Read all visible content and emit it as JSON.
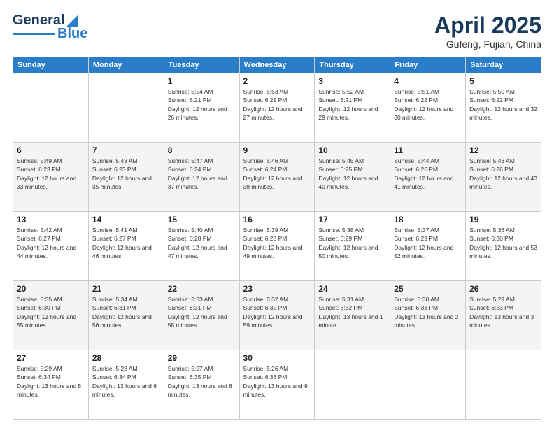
{
  "header": {
    "logo": {
      "line1": "General",
      "line2": "Blue"
    },
    "title": "April 2025",
    "subtitle": "Gufeng, Fujian, China"
  },
  "days_of_week": [
    "Sunday",
    "Monday",
    "Tuesday",
    "Wednesday",
    "Thursday",
    "Friday",
    "Saturday"
  ],
  "weeks": [
    [
      {
        "day": "",
        "info": ""
      },
      {
        "day": "",
        "info": ""
      },
      {
        "day": "1",
        "sunrise": "5:54 AM",
        "sunset": "6:21 PM",
        "daylight": "12 hours and 26 minutes."
      },
      {
        "day": "2",
        "sunrise": "5:53 AM",
        "sunset": "6:21 PM",
        "daylight": "12 hours and 27 minutes."
      },
      {
        "day": "3",
        "sunrise": "5:52 AM",
        "sunset": "6:21 PM",
        "daylight": "12 hours and 29 minutes."
      },
      {
        "day": "4",
        "sunrise": "5:51 AM",
        "sunset": "6:22 PM",
        "daylight": "12 hours and 30 minutes."
      },
      {
        "day": "5",
        "sunrise": "5:50 AM",
        "sunset": "6:22 PM",
        "daylight": "12 hours and 32 minutes."
      }
    ],
    [
      {
        "day": "6",
        "sunrise": "5:49 AM",
        "sunset": "6:23 PM",
        "daylight": "12 hours and 33 minutes."
      },
      {
        "day": "7",
        "sunrise": "5:48 AM",
        "sunset": "6:23 PM",
        "daylight": "12 hours and 35 minutes."
      },
      {
        "day": "8",
        "sunrise": "5:47 AM",
        "sunset": "6:24 PM",
        "daylight": "12 hours and 37 minutes."
      },
      {
        "day": "9",
        "sunrise": "5:46 AM",
        "sunset": "6:24 PM",
        "daylight": "12 hours and 38 minutes."
      },
      {
        "day": "10",
        "sunrise": "5:45 AM",
        "sunset": "6:25 PM",
        "daylight": "12 hours and 40 minutes."
      },
      {
        "day": "11",
        "sunrise": "5:44 AM",
        "sunset": "6:26 PM",
        "daylight": "12 hours and 41 minutes."
      },
      {
        "day": "12",
        "sunrise": "5:43 AM",
        "sunset": "6:26 PM",
        "daylight": "12 hours and 43 minutes."
      }
    ],
    [
      {
        "day": "13",
        "sunrise": "5:42 AM",
        "sunset": "6:27 PM",
        "daylight": "12 hours and 44 minutes."
      },
      {
        "day": "14",
        "sunrise": "5:41 AM",
        "sunset": "6:27 PM",
        "daylight": "12 hours and 46 minutes."
      },
      {
        "day": "15",
        "sunrise": "5:40 AM",
        "sunset": "6:28 PM",
        "daylight": "12 hours and 47 minutes."
      },
      {
        "day": "16",
        "sunrise": "5:39 AM",
        "sunset": "6:28 PM",
        "daylight": "12 hours and 49 minutes."
      },
      {
        "day": "17",
        "sunrise": "5:38 AM",
        "sunset": "6:29 PM",
        "daylight": "12 hours and 50 minutes."
      },
      {
        "day": "18",
        "sunrise": "5:37 AM",
        "sunset": "6:29 PM",
        "daylight": "12 hours and 52 minutes."
      },
      {
        "day": "19",
        "sunrise": "5:36 AM",
        "sunset": "6:30 PM",
        "daylight": "12 hours and 53 minutes."
      }
    ],
    [
      {
        "day": "20",
        "sunrise": "5:35 AM",
        "sunset": "6:30 PM",
        "daylight": "12 hours and 55 minutes."
      },
      {
        "day": "21",
        "sunrise": "5:34 AM",
        "sunset": "6:31 PM",
        "daylight": "12 hours and 56 minutes."
      },
      {
        "day": "22",
        "sunrise": "5:33 AM",
        "sunset": "6:31 PM",
        "daylight": "12 hours and 58 minutes."
      },
      {
        "day": "23",
        "sunrise": "5:32 AM",
        "sunset": "6:32 PM",
        "daylight": "12 hours and 59 minutes."
      },
      {
        "day": "24",
        "sunrise": "5:31 AM",
        "sunset": "6:32 PM",
        "daylight": "13 hours and 1 minute."
      },
      {
        "day": "25",
        "sunrise": "5:30 AM",
        "sunset": "6:33 PM",
        "daylight": "13 hours and 2 minutes."
      },
      {
        "day": "26",
        "sunrise": "5:29 AM",
        "sunset": "6:33 PM",
        "daylight": "13 hours and 3 minutes."
      }
    ],
    [
      {
        "day": "27",
        "sunrise": "5:29 AM",
        "sunset": "6:34 PM",
        "daylight": "13 hours and 5 minutes."
      },
      {
        "day": "28",
        "sunrise": "5:28 AM",
        "sunset": "6:34 PM",
        "daylight": "13 hours and 6 minutes."
      },
      {
        "day": "29",
        "sunrise": "5:27 AM",
        "sunset": "6:35 PM",
        "daylight": "13 hours and 8 minutes."
      },
      {
        "day": "30",
        "sunrise": "5:26 AM",
        "sunset": "6:36 PM",
        "daylight": "13 hours and 9 minutes."
      },
      {
        "day": "",
        "info": ""
      },
      {
        "day": "",
        "info": ""
      },
      {
        "day": "",
        "info": ""
      }
    ]
  ]
}
